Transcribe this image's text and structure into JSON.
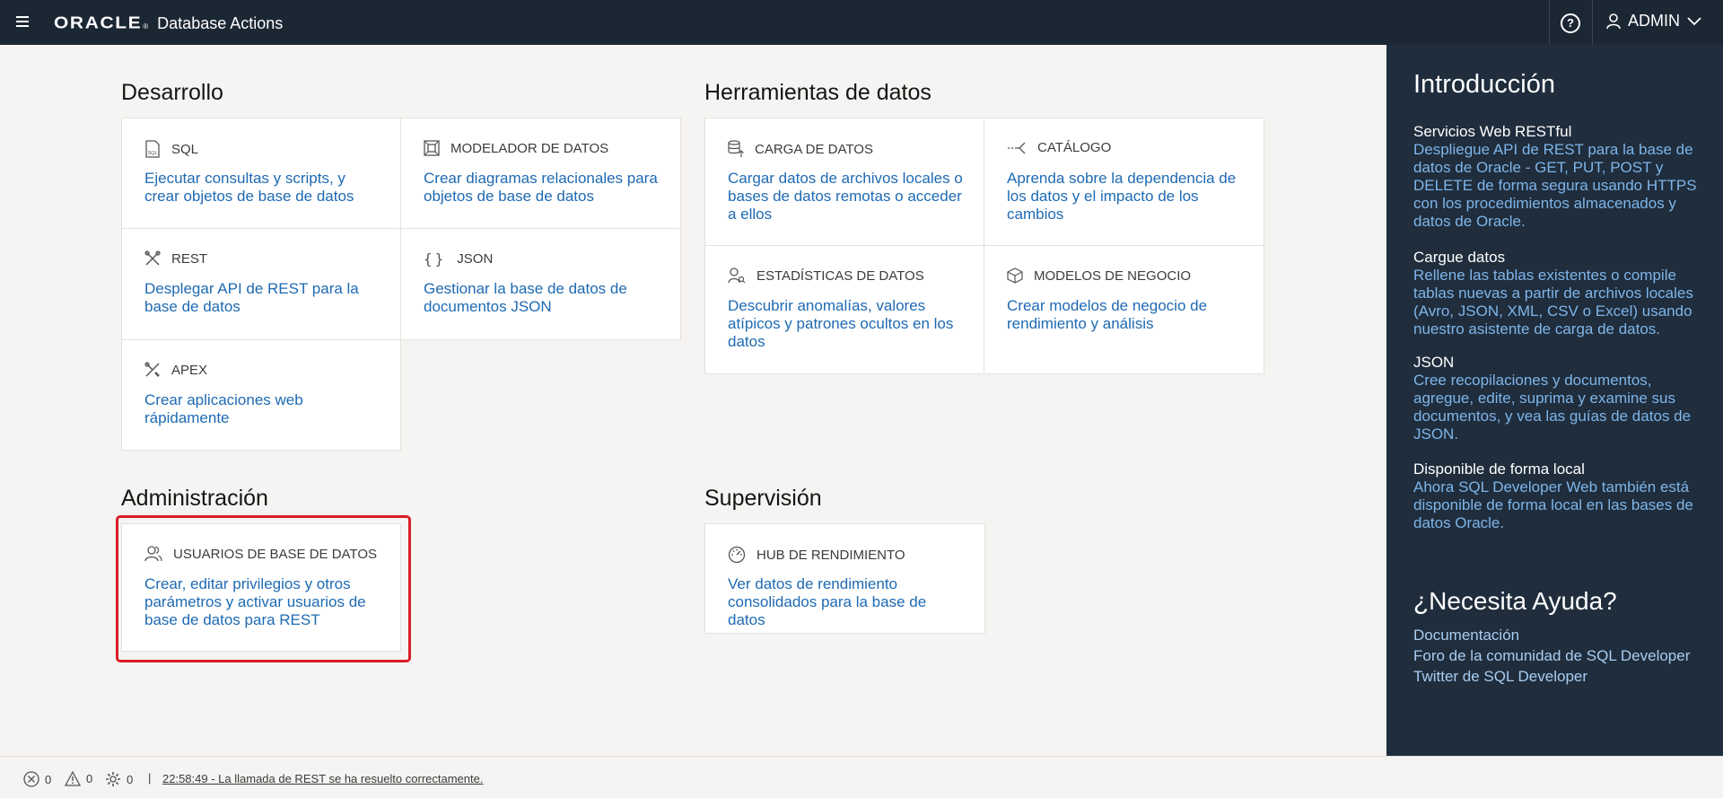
{
  "header": {
    "brand": "ORACLE",
    "app_title": "Database Actions",
    "help_symbol": "?",
    "user": "ADMIN"
  },
  "sections": {
    "desarrollo": {
      "title": "Desarrollo",
      "cards": [
        {
          "label": "SQL",
          "desc": "Ejecutar consultas y scripts, y crear objetos de base de datos",
          "icon": "sql-file-icon"
        },
        {
          "label": "MODELADOR DE DATOS",
          "desc": "Crear diagramas relacionales para objetos de base de datos",
          "icon": "data-modeler-icon"
        },
        {
          "label": "REST",
          "desc": "Desplegar API de REST para la base de datos",
          "icon": "rest-tools-icon"
        },
        {
          "label": "JSON",
          "desc": "Gestionar la base de datos de documentos JSON",
          "icon": "braces-icon"
        },
        {
          "label": "APEX",
          "desc": "Crear aplicaciones web rápidamente",
          "icon": "apex-icon"
        }
      ]
    },
    "herramientas": {
      "title": "Herramientas de datos",
      "cards": [
        {
          "label": "CARGA DE DATOS",
          "desc": "Cargar datos de archivos locales o bases de datos remotas o acceder a ellos",
          "icon": "data-load-icon"
        },
        {
          "label": "CATÁLOGO",
          "desc": "Aprenda sobre la dependencia de los datos y el impacto de los cambios",
          "icon": "catalog-icon"
        },
        {
          "label": "ESTADÍSTICAS DE DATOS",
          "desc": "Descubrir anomalías, valores atípicos y patrones ocultos en los datos",
          "icon": "data-insights-icon"
        },
        {
          "label": "MODELOS DE NEGOCIO",
          "desc": "Crear modelos de negocio de rendimiento y análisis",
          "icon": "cube-icon"
        }
      ]
    },
    "administracion": {
      "title": "Administración",
      "cards": [
        {
          "label": "USUARIOS DE BASE DE DATOS",
          "desc": "Crear, editar privilegios y otros parámetros y activar usuarios de base de datos para REST",
          "icon": "users-icon"
        }
      ]
    },
    "supervision": {
      "title": "Supervisión",
      "cards": [
        {
          "label": "HUB DE RENDIMIENTO",
          "desc": "Ver datos de rendimiento consolidados para la base de datos",
          "icon": "gauge-icon"
        }
      ]
    }
  },
  "panel": {
    "title": "Introducción",
    "items": [
      {
        "title": "Servicios Web RESTful",
        "desc": "Despliegue API de REST para la base de datos de Oracle - GET, PUT, POST y DELETE de forma segura usando HTTPS con los procedimientos almacenados y datos de Oracle."
      },
      {
        "title": "Cargue datos",
        "desc": "Rellene las tablas existentes o compile tablas nuevas a partir de archivos locales (Avro, JSON, XML, CSV o Excel) usando nuestro asistente de carga de datos."
      },
      {
        "title": "JSON",
        "desc": "Cree recopilaciones y documentos, agregue, edite, suprima y examine sus documentos, y vea las guías de datos de JSON."
      },
      {
        "title": "Disponible de forma local",
        "desc": "Ahora SQL Developer Web también está disponible de forma local en las bases de datos Oracle."
      }
    ],
    "help_title": "¿Necesita Ayuda?",
    "links": [
      "Documentación",
      "Foro de la comunidad de SQL Developer",
      "Twitter de SQL Developer"
    ]
  },
  "footer": {
    "errors": "0",
    "warnings": "0",
    "settings": "0",
    "separator": "|",
    "message": "22:58:49 - La llamada de REST se ha resuelto correctamente."
  }
}
